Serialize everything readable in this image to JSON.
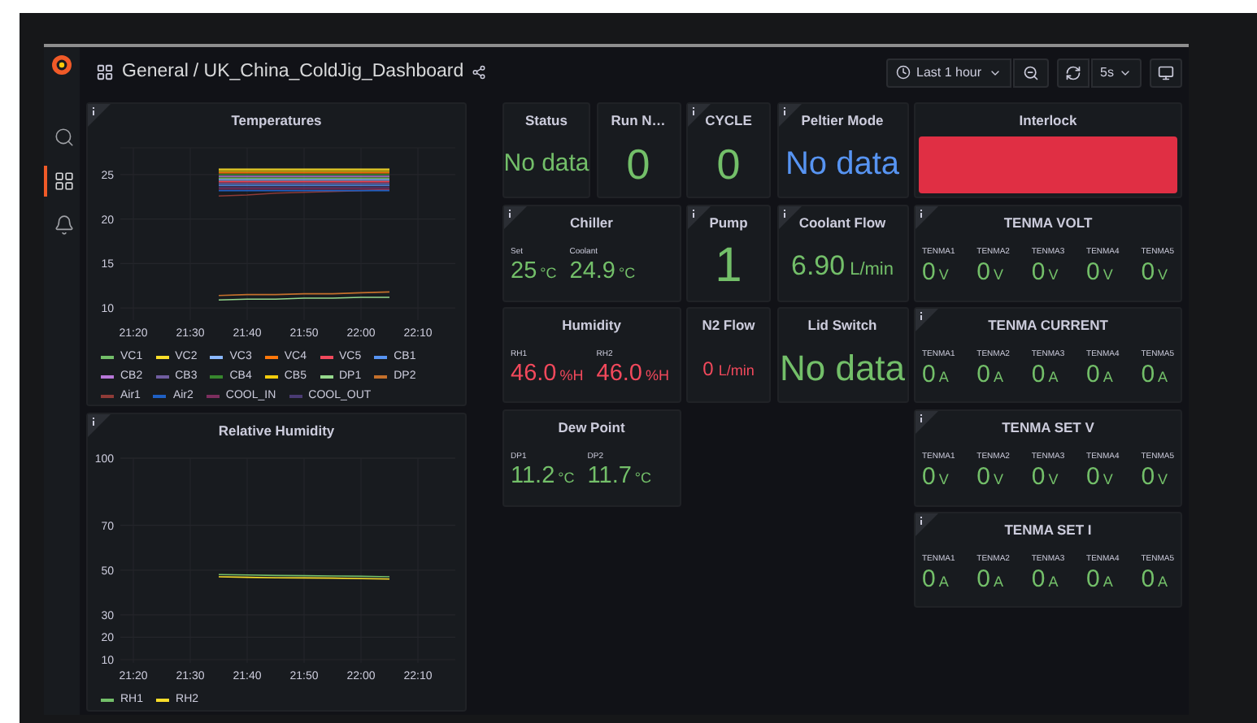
{
  "sidebar": {
    "items": [
      {
        "kind": "search",
        "selected": false
      },
      {
        "kind": "dashboards",
        "selected": true
      },
      {
        "kind": "alerts",
        "selected": false
      }
    ]
  },
  "header": {
    "folder": "General",
    "title": "/ UK_China_ColdJig_Dashboard",
    "time_range": "Last 1 hour",
    "refresh": "5s"
  },
  "charts": [
    {
      "info": true,
      "chart_data": {
        "type": "line",
        "title": "Temperatures",
        "grid": true,
        "categories": [
          "21:20",
          null,
          "21:30",
          null,
          "21:40",
          null,
          "21:50",
          null,
          "22:00",
          null,
          "22:10"
        ],
        "ylim": [
          9,
          28
        ],
        "yticks": [
          10,
          15,
          20,
          25
        ],
        "series": [
          {
            "name": "VC1",
            "color": "#73bf69",
            "values": [
              null,
              null,
              null,
              24.6,
              24.6,
              24.6,
              24.6,
              24.6,
              24.6,
              24.6,
              null
            ]
          },
          {
            "name": "VC2",
            "color": "#fade2a",
            "values": [
              null,
              null,
              null,
              25.6,
              25.6,
              25.6,
              25.6,
              25.6,
              25.6,
              25.6,
              null
            ]
          },
          {
            "name": "VC3",
            "color": "#8ab8ff",
            "values": [
              null,
              null,
              null,
              24.4,
              24.4,
              24.4,
              24.4,
              24.4,
              24.4,
              24.4,
              null
            ]
          },
          {
            "name": "VC4",
            "color": "#ff780a",
            "values": [
              null,
              null,
              null,
              25.2,
              25.2,
              25.2,
              25.2,
              25.2,
              25.2,
              25.2,
              null
            ]
          },
          {
            "name": "VC5",
            "color": "#f2495c",
            "values": [
              null,
              null,
              null,
              24.2,
              24.2,
              24.2,
              24.2,
              24.2,
              24.2,
              24.2,
              null
            ]
          },
          {
            "name": "CB1",
            "color": "#5794f2",
            "values": [
              null,
              null,
              null,
              23.8,
              23.8,
              23.8,
              23.8,
              23.8,
              23.8,
              23.8,
              null
            ]
          },
          {
            "name": "CB2",
            "color": "#b877d9",
            "values": [
              null,
              null,
              null,
              24.8,
              24.8,
              24.8,
              24.8,
              24.8,
              24.8,
              24.8,
              null
            ]
          },
          {
            "name": "CB3",
            "color": "#705da0",
            "values": [
              null,
              null,
              null,
              24.0,
              24.0,
              24.0,
              24.0,
              24.0,
              24.0,
              24.0,
              null
            ]
          },
          {
            "name": "CB4",
            "color": "#37872d",
            "values": [
              null,
              null,
              null,
              25.0,
              25.0,
              25.0,
              25.0,
              25.0,
              25.0,
              25.0,
              null
            ]
          },
          {
            "name": "CB5",
            "color": "#f2cc0c",
            "values": [
              null,
              null,
              null,
              25.4,
              25.4,
              25.4,
              25.4,
              25.4,
              25.4,
              25.4,
              null
            ]
          },
          {
            "name": "DP1",
            "color": "#96d98d",
            "values": [
              null,
              null,
              null,
              10.9,
              11.0,
              11.0,
              11.1,
              11.1,
              11.2,
              11.2,
              null
            ]
          },
          {
            "name": "DP2",
            "color": "#c4702b",
            "values": [
              null,
              null,
              null,
              11.4,
              11.5,
              11.5,
              11.6,
              11.6,
              11.7,
              11.8,
              null
            ]
          },
          {
            "name": "Air1",
            "color": "#8f3b37",
            "values": [
              null,
              null,
              null,
              22.6,
              22.7,
              22.9,
              23.0,
              23.1,
              23.2,
              23.3,
              null
            ]
          },
          {
            "name": "Air2",
            "color": "#1f60c4",
            "values": [
              null,
              null,
              null,
              23.2,
              23.2,
              23.2,
              23.2,
              23.2,
              23.2,
              23.2,
              null
            ]
          },
          {
            "name": "COOL_IN",
            "color": "#7c2e5e",
            "values": [
              null,
              null,
              null,
              23.4,
              23.4,
              23.4,
              23.4,
              23.4,
              23.4,
              23.4,
              null
            ]
          },
          {
            "name": "COOL_OUT",
            "color": "#4a3b73",
            "values": [
              null,
              null,
              null,
              23.6,
              23.6,
              23.6,
              23.6,
              23.6,
              23.6,
              23.6,
              null
            ]
          }
        ]
      }
    },
    {
      "info": true,
      "chart_data": {
        "type": "line",
        "title": "Relative Humidity",
        "grid": true,
        "categories": [
          "21:20",
          null,
          "21:30",
          null,
          "21:40",
          null,
          "21:50",
          null,
          "22:00",
          null,
          "22:10"
        ],
        "ylim": [
          10,
          100
        ],
        "yticks": [
          10,
          20,
          30,
          50,
          70,
          100
        ],
        "series": [
          {
            "name": "RH1",
            "color": "#73bf69",
            "values": [
              null,
              null,
              null,
              48.0,
              47.8,
              47.6,
              47.5,
              47.4,
              47.2,
              47.0,
              null
            ]
          },
          {
            "name": "RH2",
            "color": "#fade2a",
            "values": [
              null,
              null,
              null,
              47.0,
              46.8,
              46.6,
              46.5,
              46.4,
              46.2,
              46.0,
              null
            ]
          }
        ]
      }
    }
  ],
  "panels": [
    {
      "title": "Status",
      "info": false,
      "kind": "single",
      "values": [
        {
          "value": "No data",
          "color": "#73bf69"
        }
      ]
    },
    {
      "title": "Run N…",
      "info": false,
      "kind": "single",
      "values": [
        {
          "value": "0",
          "color": "#73bf69"
        }
      ]
    },
    {
      "title": "CYCLE",
      "info": true,
      "kind": "single",
      "values": [
        {
          "value": "0",
          "color": "#73bf69"
        }
      ]
    },
    {
      "title": "Peltier Mode",
      "info": true,
      "kind": "single",
      "values": [
        {
          "value": "No data",
          "color": "#5794f2"
        }
      ]
    },
    {
      "title": "Interlock",
      "info": false,
      "kind": "block",
      "color": "#e02f44"
    },
    {
      "title": "Chiller",
      "info": true,
      "kind": "multi",
      "values": [
        {
          "label": "Set",
          "value": "25",
          "unit": "°C",
          "color": "#73bf69"
        },
        {
          "label": "Coolant",
          "value": "24.9",
          "unit": "°C",
          "color": "#73bf69"
        }
      ]
    },
    {
      "title": "Pump",
      "info": true,
      "kind": "single",
      "values": [
        {
          "value": "1",
          "color": "#73bf69"
        }
      ]
    },
    {
      "title": "Coolant Flow",
      "info": true,
      "kind": "single",
      "values": [
        {
          "value": "6.90",
          "unit": "L/min",
          "color": "#73bf69"
        }
      ]
    },
    {
      "title": "TENMA VOLT",
      "info": true,
      "kind": "multi",
      "values": [
        {
          "label": "TENMA1",
          "value": "0",
          "unit": "V",
          "color": "#73bf69"
        },
        {
          "label": "TENMA2",
          "value": "0",
          "unit": "V",
          "color": "#73bf69"
        },
        {
          "label": "TENMA3",
          "value": "0",
          "unit": "V",
          "color": "#73bf69"
        },
        {
          "label": "TENMA4",
          "value": "0",
          "unit": "V",
          "color": "#73bf69"
        },
        {
          "label": "TENMA5",
          "value": "0",
          "unit": "V",
          "color": "#73bf69"
        }
      ]
    },
    {
      "title": "Humidity",
      "info": false,
      "kind": "multi",
      "values": [
        {
          "label": "RH1",
          "value": "46.0",
          "unit": "%H",
          "color": "#f2495c"
        },
        {
          "label": "RH2",
          "value": "46.0",
          "unit": "%H",
          "color": "#f2495c"
        }
      ]
    },
    {
      "title": "N2 Flow",
      "info": false,
      "kind": "single",
      "values": [
        {
          "value": "0",
          "unit": "L/min",
          "color": "#f2495c"
        }
      ]
    },
    {
      "title": "Lid Switch",
      "info": false,
      "kind": "single",
      "values": [
        {
          "value": "No data",
          "color": "#73bf69"
        }
      ]
    },
    {
      "title": "TENMA CURRENT",
      "info": true,
      "kind": "multi",
      "values": [
        {
          "label": "TENMA1",
          "value": "0",
          "unit": "A",
          "color": "#73bf69"
        },
        {
          "label": "TENMA2",
          "value": "0",
          "unit": "A",
          "color": "#73bf69"
        },
        {
          "label": "TENMA3",
          "value": "0",
          "unit": "A",
          "color": "#73bf69"
        },
        {
          "label": "TENMA4",
          "value": "0",
          "unit": "A",
          "color": "#73bf69"
        },
        {
          "label": "TENMA5",
          "value": "0",
          "unit": "A",
          "color": "#73bf69"
        }
      ]
    },
    {
      "title": "Dew Point",
      "info": false,
      "kind": "multi",
      "values": [
        {
          "label": "DP1",
          "value": "11.2",
          "unit": "°C",
          "color": "#73bf69"
        },
        {
          "label": "DP2",
          "value": "11.7",
          "unit": "°C",
          "color": "#73bf69"
        }
      ]
    },
    {
      "title": "TENMA SET V",
      "info": true,
      "kind": "multi",
      "values": [
        {
          "label": "TENMA1",
          "value": "0",
          "unit": "V",
          "color": "#73bf69"
        },
        {
          "label": "TENMA2",
          "value": "0",
          "unit": "V",
          "color": "#73bf69"
        },
        {
          "label": "TENMA3",
          "value": "0",
          "unit": "V",
          "color": "#73bf69"
        },
        {
          "label": "TENMA4",
          "value": "0",
          "unit": "V",
          "color": "#73bf69"
        },
        {
          "label": "TENMA5",
          "value": "0",
          "unit": "V",
          "color": "#73bf69"
        }
      ]
    },
    {
      "title": "TENMA SET I",
      "info": true,
      "kind": "multi",
      "values": [
        {
          "label": "TENMA1",
          "value": "0",
          "unit": "A",
          "color": "#73bf69"
        },
        {
          "label": "TENMA2",
          "value": "0",
          "unit": "A",
          "color": "#73bf69"
        },
        {
          "label": "TENMA3",
          "value": "0",
          "unit": "A",
          "color": "#73bf69"
        },
        {
          "label": "TENMA4",
          "value": "0",
          "unit": "A",
          "color": "#73bf69"
        },
        {
          "label": "TENMA5",
          "value": "0",
          "unit": "A",
          "color": "#73bf69"
        }
      ]
    }
  ]
}
